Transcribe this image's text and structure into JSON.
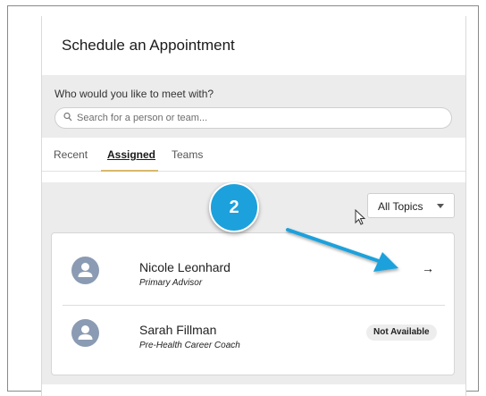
{
  "page": {
    "title": "Schedule an Appointment"
  },
  "search": {
    "prompt": "Who would you like to meet with?",
    "placeholder": "Search for a person or team...",
    "icon": "search-icon"
  },
  "tabs": [
    {
      "label": "Recent",
      "active": false
    },
    {
      "label": "Assigned",
      "active": true
    },
    {
      "label": "Teams",
      "active": false
    }
  ],
  "filter": {
    "selected": "All Topics",
    "icon": "chevron-down-icon"
  },
  "people": [
    {
      "name": "Nicole Leonhard",
      "role": "Primary Advisor",
      "action_icon": "arrow-right-icon",
      "action_glyph": "→"
    },
    {
      "name": "Sarah Fillman",
      "role": "Pre-Health Career Coach",
      "status": "Not Available"
    }
  ],
  "annotation": {
    "step": "2",
    "color": "#1da1dc"
  },
  "colors": {
    "accent_underline": "#d8b86a",
    "avatar": "#8a9bb3",
    "band": "#ececec"
  }
}
